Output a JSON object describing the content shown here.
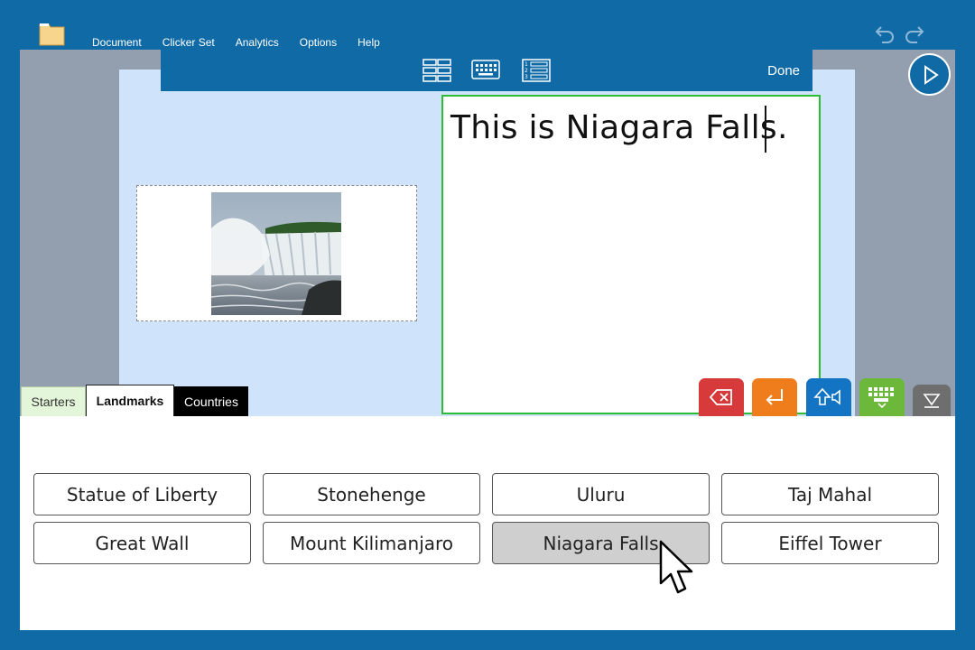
{
  "menu": [
    "Document",
    "Clicker Set",
    "Analytics",
    "Options",
    "Help"
  ],
  "toolbar": {
    "icons": [
      "grid-layout-icon",
      "keyboard-layout-icon",
      "numbered-list-icon"
    ],
    "done_label": "Done"
  },
  "document": {
    "text": "This is Niagara Falls.",
    "image": "niagara-falls-photo"
  },
  "tools": [
    {
      "name": "backspace",
      "color": "#d63a3a"
    },
    {
      "name": "enter",
      "color": "#f07d1c"
    },
    {
      "name": "speak",
      "color": "#1374c3"
    },
    {
      "name": "keyboard",
      "color": "#6cb83a"
    },
    {
      "name": "hide",
      "color": "#6e6e6e"
    }
  ],
  "tabs": [
    {
      "label": "Starters",
      "style": "light-green"
    },
    {
      "label": "Landmarks",
      "style": "selected"
    },
    {
      "label": "Countries",
      "style": "black"
    }
  ],
  "grid": {
    "cells": [
      "Statue of Liberty",
      "Stonehenge",
      "Uluru",
      "Taj Mahal",
      "Great Wall",
      "Mount Kilimanjaro",
      "Niagara Falls",
      "Eiffel Tower"
    ],
    "active": "Niagara Falls"
  },
  "colors": {
    "background": "#0f6aa6",
    "page": "#cfe3fb",
    "textbox_border": "#2ebc36"
  }
}
